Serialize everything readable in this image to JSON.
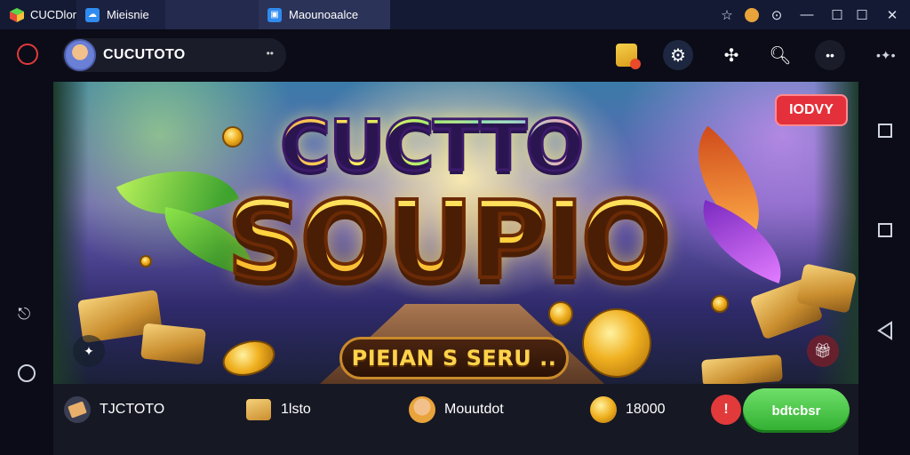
{
  "titlebar": {
    "app_name": "CUCDlor",
    "tabs": [
      {
        "label": "Mieisnie",
        "active": false
      },
      {
        "label": "Maounoaalce",
        "active": true
      }
    ],
    "icons": [
      "star-icon",
      "coin-icon",
      "record-icon",
      "minimize-icon",
      "maximize-icon",
      "restore-icon",
      "close-icon"
    ]
  },
  "header": {
    "profile_name": "CUCUTOTO",
    "profile_more": "••",
    "icons": [
      "gift-box-icon",
      "settings-icon",
      "puzzle-icon",
      "search-icon",
      "more-icon",
      "ellipsis-icon"
    ]
  },
  "banner": {
    "logo_line1": "CUCTTO",
    "logo_line2": "SOUPIO",
    "cta_label": "PIEIAN S SERU ..",
    "badge_label": "IODVY",
    "colors": {
      "badge": "#e4303a",
      "logo_gold": "#ffcc2e",
      "cta_text": "#ffd34a"
    }
  },
  "leftbar": {
    "icons": [
      "record-icon",
      "share-icon",
      "power-icon"
    ]
  },
  "rightbar": {
    "icons": [
      "square-icon",
      "square-icon",
      "back-triangle-icon"
    ]
  },
  "bottombar": {
    "stats": [
      {
        "icon": "ticket-icon",
        "label": "TJCTOTO"
      },
      {
        "icon": "gold-block-icon",
        "label": "1lsto"
      },
      {
        "icon": "avatar-icon",
        "label": "Mouutdot"
      },
      {
        "icon": "coin-icon",
        "label": "18000"
      }
    ],
    "cta_label": "bdtcbsr",
    "colors": {
      "cta": "#3fbf3a",
      "alert": "#e23a3a"
    }
  }
}
